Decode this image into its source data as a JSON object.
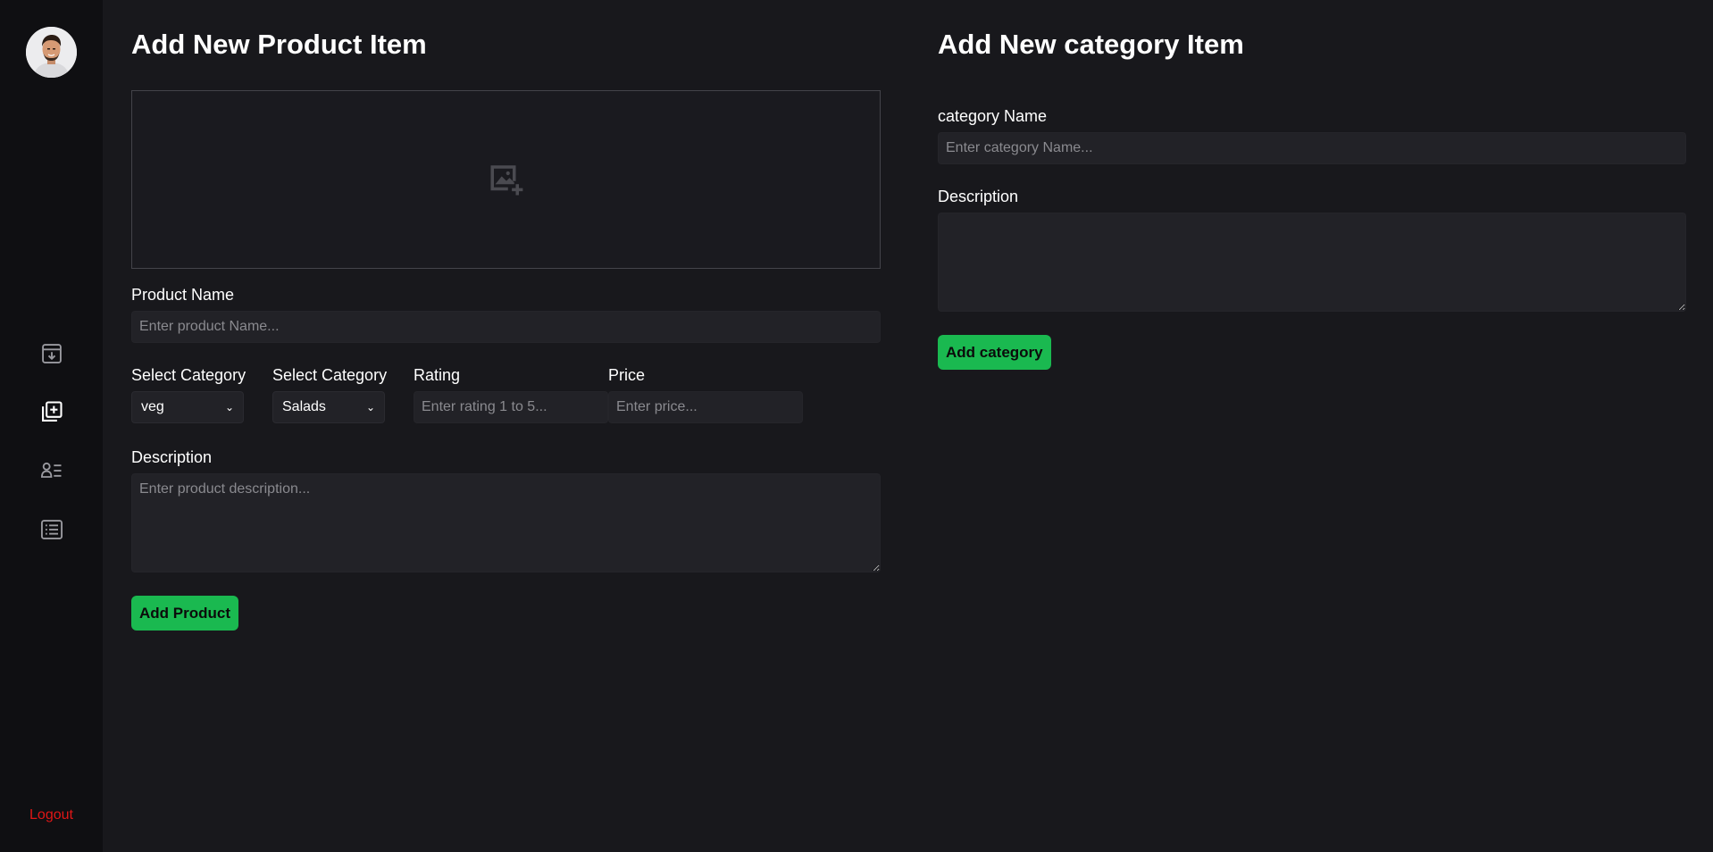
{
  "sidebar": {
    "avatar_alt": "user avatar",
    "items": [
      {
        "icon": "archive-download-icon"
      },
      {
        "icon": "add-box-icon"
      },
      {
        "icon": "user-list-icon"
      },
      {
        "icon": "list-icon"
      }
    ],
    "logout_label": "Logout"
  },
  "product_form": {
    "title": "Add New Product Item",
    "upload_icon": "add-image-icon",
    "product_name_label": "Product Name",
    "product_name_placeholder": "Enter product Name...",
    "category1_label": "Select Category",
    "category1_value": "veg",
    "category2_label": "Select Category",
    "category2_value": "Salads",
    "rating_label": "Rating",
    "rating_placeholder": "Enter rating 1 to 5...",
    "price_label": "Price",
    "price_placeholder": "Enter price...",
    "description_label": "Description",
    "description_placeholder": "Enter product description...",
    "submit_label": "Add Product"
  },
  "category_form": {
    "title": "Add New category Item",
    "name_label": "category Name",
    "name_placeholder": "Enter category Name...",
    "description_label": "Description",
    "description_placeholder": "",
    "submit_label": "Add category"
  },
  "colors": {
    "background": "#18181c",
    "sidebar": "#0f0f12",
    "accent": "#1ab950",
    "logout": "#e01616"
  }
}
